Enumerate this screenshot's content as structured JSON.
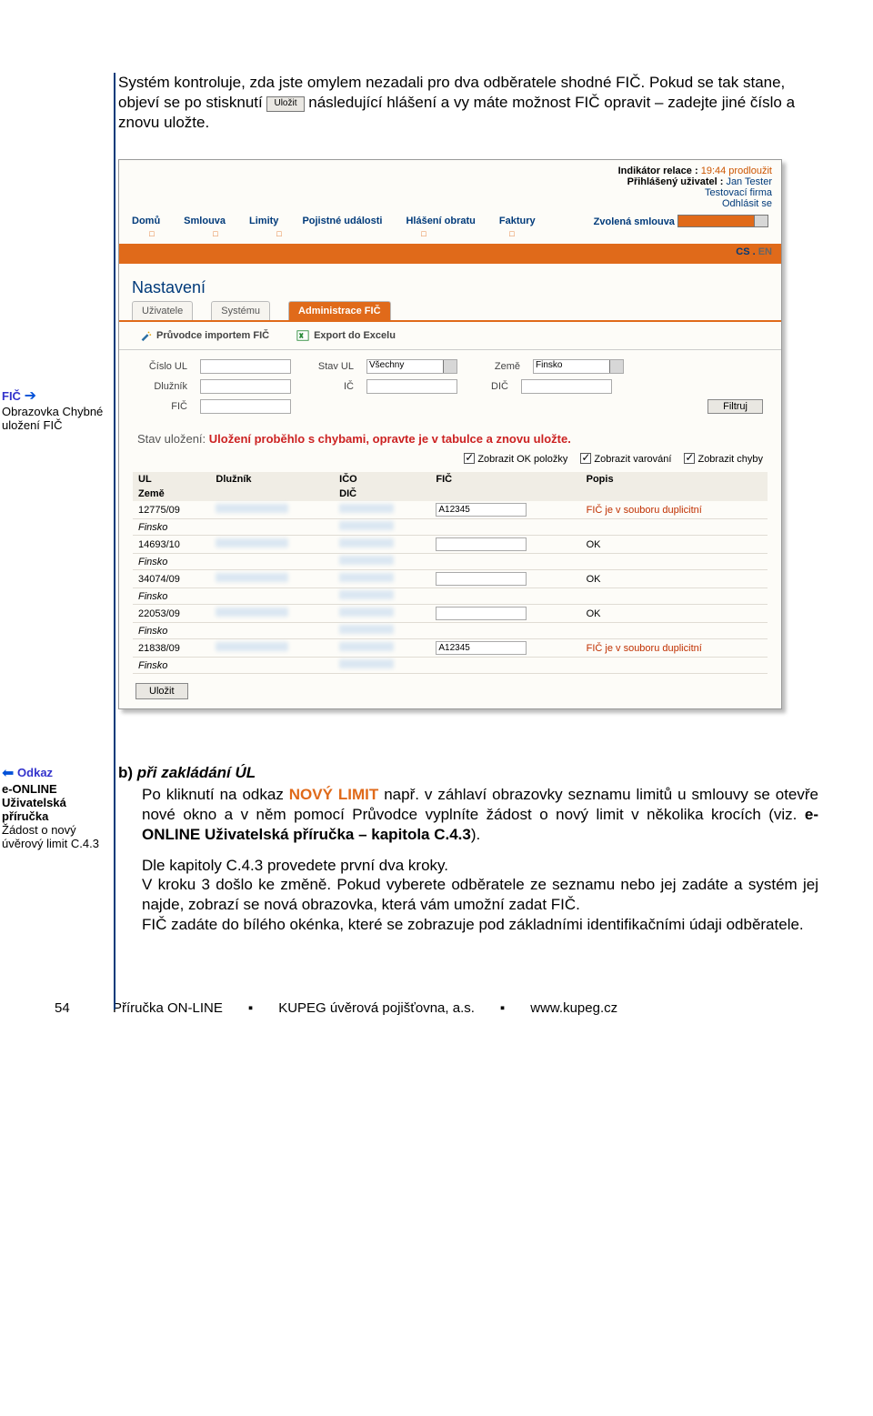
{
  "paragraph1": {
    "line1": "Systém kontroluje, zda jste omylem nezadali pro dva odběratele shodné FIČ. Pokud se tak stane, objeví se po stisknutí ",
    "btn": "Uložit",
    "line2": "následující hlášení a vy máte možnost FIČ opravit – zadejte jiné číslo a znovu uložte."
  },
  "blue_box_top": {
    "title": "FIČ",
    "text": "Obrazovka Chybné uložení FIČ"
  },
  "blue_box_bottom": {
    "odkaz": "Odkaz",
    "text_bold": "e-ONLINE Uživatelská příručka",
    "text_rest": "Žádost o nový úvěrový limit C.4.3"
  },
  "scr": {
    "ind_label": "Indikátor relace :",
    "ind_time": "19:44",
    "prod": "prodloužit",
    "prih": "Přihlášený uživatel :",
    "user": "Jan Tester",
    "firma": "Testovací firma",
    "logout": "Odhlásit se",
    "nav": [
      "Domů",
      "Smlouva",
      "Limity",
      "Pojistné události",
      "Hlášení obratu",
      "Faktury"
    ],
    "zvolena": "Zvolená smlouva",
    "langs": {
      "cs": "CS",
      "en": "EN"
    },
    "section": "Nastavení",
    "tabs": [
      "Uživatele",
      "Systému",
      "Administrace FIČ"
    ],
    "toolbar": {
      "importer": "Průvodce importem FIČ",
      "export": "Export do Excelu"
    },
    "form": {
      "cislo_ul": "Číslo UL",
      "stav_ul": "Stav UL",
      "stav_ul_val": "Všechny",
      "zeme": "Země",
      "zeme_val": "Finsko",
      "dluznik": "Dlužník",
      "ic": "IČ",
      "dic": "DIČ",
      "fic": "FIČ",
      "filtruj": "Filtruj"
    },
    "stav": {
      "label": "Stav uložení: ",
      "msg": "Uložení proběhlo s chybami, opravte je v tabulce a znovu uložte."
    },
    "checks": {
      "ok": "Zobrazit OK položky",
      "warn": "Zobrazit varování",
      "err": "Zobrazit chyby"
    },
    "tbl_head": {
      "ul": "UL",
      "dl": "Dlužník",
      "zeme": "Země",
      "ico": "IČO",
      "dic": "DIČ",
      "fic": "FIČ",
      "popis": "Popis"
    },
    "rows": [
      {
        "ul": "12775/09",
        "zeme": "Finsko",
        "fic": "A12345",
        "popis": "FIČ je v souboru duplicitní",
        "dupe": true
      },
      {
        "ul": "14693/10",
        "zeme": "Finsko",
        "fic": "",
        "popis": "OK",
        "dupe": false
      },
      {
        "ul": "34074/09",
        "zeme": "Finsko",
        "fic": "",
        "popis": "OK",
        "dupe": false
      },
      {
        "ul": "22053/09",
        "zeme": "Finsko",
        "fic": "",
        "popis": "OK",
        "dupe": false
      },
      {
        "ul": "21838/09",
        "zeme": "Finsko",
        "fic": "A12345",
        "popis": "FIČ je v souboru duplicitní",
        "dupe": true
      }
    ],
    "save": "Uložit"
  },
  "body": {
    "bullet": "b)",
    "boldline": "při zakládání ÚL",
    "p1_a": "Po kliknutí na odkaz ",
    "p1_link": "NOVÝ LIMIT",
    "p1_b": " např. v záhlaví obrazovky seznamu limitů u smlouvy se otevře nové okno a v něm pomocí Průvodce vyplníte žádost o nový limit v několika krocích (viz. ",
    "p1_c": "e-ONLINE Uživatelská příručka – kapitola C.4.3",
    "p1_d": ").",
    "p2": "Dle kapitoly C.4.3 provedete první dva kroky.",
    "p3": "V kroku 3 došlo ke změně. Pokud vyberete odběratele ze seznamu nebo jej zadáte a systém jej najde, zobrazí se nová obrazovka, která vám umožní zadat FIČ.",
    "p4": "FIČ zadáte do bílého okénka, které se zobrazuje pod základními identifikačními údaji odběratele."
  },
  "footer": {
    "page": "54",
    "t1": "Příručka ON-LINE",
    "t2": "KUPEG úvěrová pojišťovna, a.s.",
    "t3": "www.kupeg.cz",
    "sep": "▪"
  }
}
